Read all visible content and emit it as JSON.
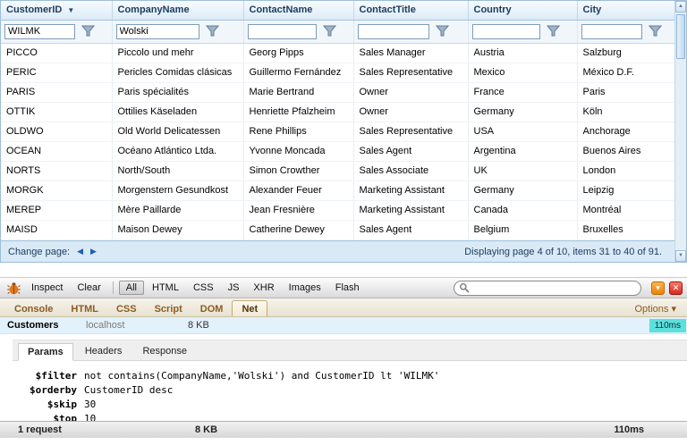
{
  "colors": {
    "accent_blue": "#1b62a8",
    "badge_cyan": "#5ce0db",
    "header_text": "#1b3c5f"
  },
  "grid": {
    "columns": [
      {
        "label": "CustomerID",
        "filter_value": "WILMK",
        "sorted": "desc"
      },
      {
        "label": "CompanyName",
        "filter_value": "Wolski",
        "sorted": ""
      },
      {
        "label": "ContactName",
        "filter_value": "",
        "sorted": ""
      },
      {
        "label": "ContactTitle",
        "filter_value": "",
        "sorted": ""
      },
      {
        "label": "Country",
        "filter_value": "",
        "sorted": ""
      },
      {
        "label": "City",
        "filter_value": "",
        "sorted": ""
      }
    ],
    "rows": [
      [
        "PICCO",
        "Piccolo und mehr",
        "Georg Pipps",
        "Sales Manager",
        "Austria",
        "Salzburg"
      ],
      [
        "PERIC",
        "Pericles Comidas clásicas",
        "Guillermo Fernández",
        "Sales Representative",
        "Mexico",
        "México D.F."
      ],
      [
        "PARIS",
        "Paris spécialités",
        "Marie Bertrand",
        "Owner",
        "France",
        "Paris"
      ],
      [
        "OTTIK",
        "Ottilies Käseladen",
        "Henriette Pfalzheim",
        "Owner",
        "Germany",
        "Köln"
      ],
      [
        "OLDWO",
        "Old World Delicatessen",
        "Rene Phillips",
        "Sales Representative",
        "USA",
        "Anchorage"
      ],
      [
        "OCEAN",
        "Océano Atlántico Ltda.",
        "Yvonne Moncada",
        "Sales Agent",
        "Argentina",
        "Buenos Aires"
      ],
      [
        "NORTS",
        "North/South",
        "Simon Crowther",
        "Sales Associate",
        "UK",
        "London"
      ],
      [
        "MORGK",
        "Morgenstern Gesundkost",
        "Alexander Feuer",
        "Marketing Assistant",
        "Germany",
        "Leipzig"
      ],
      [
        "MEREP",
        "Mère Paillarde",
        "Jean Fresnière",
        "Marketing Assistant",
        "Canada",
        "Montréal"
      ],
      [
        "MAISD",
        "Maison Dewey",
        "Catherine Dewey",
        "Sales Agent",
        "Belgium",
        "Bruxelles"
      ]
    ],
    "pager": {
      "label": "Change page:",
      "status": "Displaying page 4 of 10, items 31 to 40 of 91."
    }
  },
  "firebug": {
    "toolbar": {
      "inspect": "Inspect",
      "clear": "Clear",
      "filters": [
        "All",
        "HTML",
        "CSS",
        "JS",
        "XHR",
        "Images",
        "Flash"
      ],
      "active_filter": "All"
    },
    "tabs": [
      "Console",
      "HTML",
      "CSS",
      "Script",
      "DOM",
      "Net"
    ],
    "active_tab": "Net",
    "options_label": "Options",
    "request": {
      "name": "Customers",
      "domain": "localhost",
      "size": "8 KB",
      "time": "110ms"
    },
    "detail_tabs": [
      "Params",
      "Headers",
      "Response"
    ],
    "active_detail_tab": "Params",
    "params": [
      {
        "key": "$filter",
        "value": "not contains(CompanyName,'Wolski') and CustomerID lt 'WILMK'"
      },
      {
        "key": "$orderby",
        "value": "CustomerID desc"
      },
      {
        "key": "$skip",
        "value": "30"
      },
      {
        "key": "$top",
        "value": "10"
      }
    ],
    "status": {
      "requests": "1 request",
      "size": "8 KB",
      "time": "110ms"
    }
  },
  "icons": {
    "sort_desc": "▼",
    "page_prev": "◀",
    "page_next": "▶",
    "scroll_up": "▲",
    "scroll_down": "▼",
    "caret_down": "▾",
    "close": "✕",
    "minimize": "▾"
  }
}
